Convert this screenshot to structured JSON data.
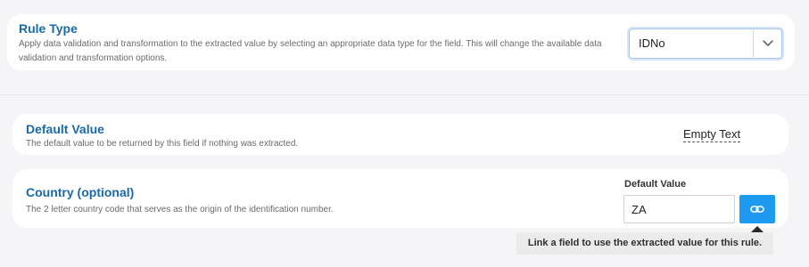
{
  "rule_type": {
    "title": "Rule Type",
    "description": "Apply data validation and transformation to the extracted value by selecting an appropriate data type for the field. This will change the available data validation and transformation options.",
    "selected_value": "IDNo"
  },
  "default_value": {
    "title": "Default Value",
    "description": "The default value to be returned by this field if nothing was extracted.",
    "value": "Empty Text"
  },
  "country": {
    "title": "Country (optional)",
    "description": "The 2 letter country code that serves as the origin of the identification number.",
    "field_label": "Default Value",
    "input_value": "ZA",
    "tooltip": "Link a field to use the extracted value for this rule."
  },
  "colors": {
    "accent": "#1e9bf0",
    "title": "#1a6aa8",
    "background": "#f5f5f7"
  },
  "icons": {
    "select_chevron": "chevron-down-icon",
    "link_button": "link-icon"
  }
}
